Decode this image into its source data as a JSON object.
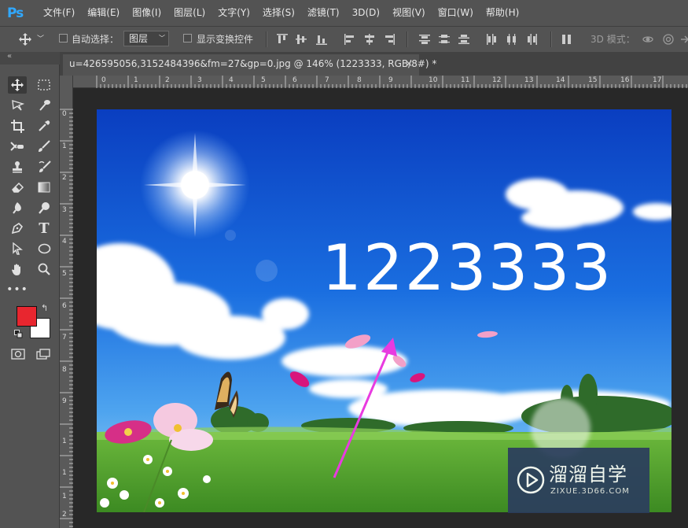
{
  "app": {
    "logo": "Ps",
    "accent": "#31a8ff"
  },
  "menu": [
    "文件(F)",
    "编辑(E)",
    "图像(I)",
    "图层(L)",
    "文字(Y)",
    "选择(S)",
    "滤镜(T)",
    "3D(D)",
    "视图(V)",
    "窗口(W)",
    "帮助(H)"
  ],
  "options": {
    "auto_select_label": "自动选择：",
    "auto_select_value": "图层",
    "show_transform_label": "显示变换控件",
    "mode_3d_label": "3D 模式："
  },
  "document": {
    "tab_title": "u=426595056,3152484396&fm=27&gp=0.jpg @ 146% (1223333, RGB/8#) *",
    "ruler_h_labels": [
      "0",
      "1",
      "2",
      "3",
      "4",
      "5",
      "6",
      "7",
      "8",
      "9",
      "10",
      "11",
      "12",
      "13",
      "14",
      "15",
      "16",
      "17"
    ],
    "ruler_v_labels": [
      "0",
      "1",
      "2",
      "3",
      "4",
      "5",
      "6",
      "7",
      "8",
      "9",
      "1",
      "1",
      "1",
      "2"
    ],
    "canvas_text": "1223333"
  },
  "colors": {
    "foreground": "#e8262f",
    "background": "#ffffff",
    "arrow": "#e83be0"
  },
  "watermark": {
    "title": "溜溜自学",
    "subtitle": "ZIXUE.3D66.COM"
  },
  "tools": [
    "move-icon",
    "marquee-icon",
    "lasso-icon",
    "quick-select-icon",
    "crop-icon",
    "eyedropper-icon",
    "healing-icon",
    "brush-icon",
    "stamp-icon",
    "history-brush-icon",
    "eraser-icon",
    "gradient-icon",
    "blur-icon",
    "dodge-icon",
    "pen-icon",
    "type-icon",
    "path-select-icon",
    "ellipse-icon",
    "hand-icon",
    "zoom-icon",
    "more-tools-icon"
  ]
}
